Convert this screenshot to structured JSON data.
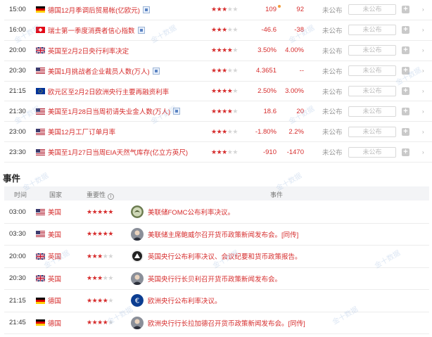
{
  "data_rows": [
    {
      "time": "15:00",
      "flag": "de",
      "name": "德国12月季调后贸易帐(亿欧元)",
      "tag": true,
      "stars": 3,
      "prev": "109",
      "prev_dot": true,
      "forecast": "92",
      "actual": "未公布",
      "input_placeholder": "未公布"
    },
    {
      "time": "16:00",
      "flag": "ch",
      "name": "瑞士第一季度消费者信心指数",
      "tag": true,
      "stars": 3,
      "prev": "-46.6",
      "prev_dot": false,
      "forecast": "-38",
      "actual": "未公布",
      "input_placeholder": "未公布"
    },
    {
      "time": "20:00",
      "flag": "gb",
      "name": "英国至2月2日央行利率决定",
      "tag": false,
      "stars": 4,
      "prev": "3.50%",
      "prev_dot": false,
      "forecast": "4.00%",
      "actual": "未公布",
      "input_placeholder": "未公布"
    },
    {
      "time": "20:30",
      "flag": "us",
      "name": "美国1月挑战者企业裁员人数(万人)",
      "tag": true,
      "stars": 3,
      "prev": "4.3651",
      "prev_dot": false,
      "forecast": "--",
      "actual": "未公布",
      "input_placeholder": "未公布"
    },
    {
      "time": "21:15",
      "flag": "eu",
      "name": "欧元区至2月2日欧洲央行主要再融资利率",
      "tag": false,
      "stars": 4,
      "prev": "2.50%",
      "prev_dot": false,
      "forecast": "3.00%",
      "actual": "未公布",
      "input_placeholder": "未公布"
    },
    {
      "time": "21:30",
      "flag": "us",
      "name": "美国至1月28日当周初请失业金人数(万人)",
      "tag": true,
      "stars": 4,
      "prev": "18.6",
      "prev_dot": false,
      "forecast": "20",
      "actual": "未公布",
      "input_placeholder": "未公布"
    },
    {
      "time": "23:00",
      "flag": "us",
      "name": "美国12月工厂订单月率",
      "tag": false,
      "stars": 3,
      "prev": "-1.80%",
      "prev_dot": false,
      "forecast": "2.2%",
      "actual": "未公布",
      "input_placeholder": "未公布"
    },
    {
      "time": "23:30",
      "flag": "us",
      "name": "美国至1月27日当周EIA天然气库存(亿立方英尺)",
      "tag": false,
      "stars": 3,
      "prev": "-910",
      "prev_dot": false,
      "forecast": "-1470",
      "actual": "未公布",
      "input_placeholder": "未公布"
    }
  ],
  "events_section": {
    "title": "事件",
    "headers": {
      "time": "时间",
      "country": "国家",
      "importance": "重要性",
      "event": "事件"
    },
    "rows": [
      {
        "time": "03:00",
        "flag": "us",
        "country": "美国",
        "stars": 5,
        "logo": "fed-seal",
        "desc": "美联储FOMC公布利率决议。"
      },
      {
        "time": "03:30",
        "flag": "us",
        "country": "美国",
        "stars": 5,
        "logo": "person-portrait",
        "desc": "美联储主席鲍威尔召开货币政策新闻发布会。[同传]"
      },
      {
        "time": "20:00",
        "flag": "gb",
        "country": "英国",
        "stars": 3,
        "logo": "boe-logo",
        "desc": "英国央行公布利率决议、会议纪要和货币政策报告。"
      },
      {
        "time": "20:30",
        "flag": "gb",
        "country": "英国",
        "stars": 3,
        "logo": "person-portrait",
        "desc": "英国央行行长贝利召开货币政策新闻发布会。"
      },
      {
        "time": "21:15",
        "flag": "de",
        "country": "德国",
        "stars": 4,
        "logo": "ecb-euro-logo",
        "desc": "欧洲央行公布利率决议。"
      },
      {
        "time": "21:45",
        "flag": "de",
        "country": "德国",
        "stars": 4,
        "logo": "person-portrait",
        "desc": "欧洲央行行长拉加德召开货币政策新闻发布会。[同传]"
      }
    ]
  },
  "watermark": "金十数据",
  "colors": {
    "accent_red": "#d62c2c",
    "star_off": "#d5d5d5",
    "header_bg": "#f3f4f6",
    "muted": "#999999"
  }
}
